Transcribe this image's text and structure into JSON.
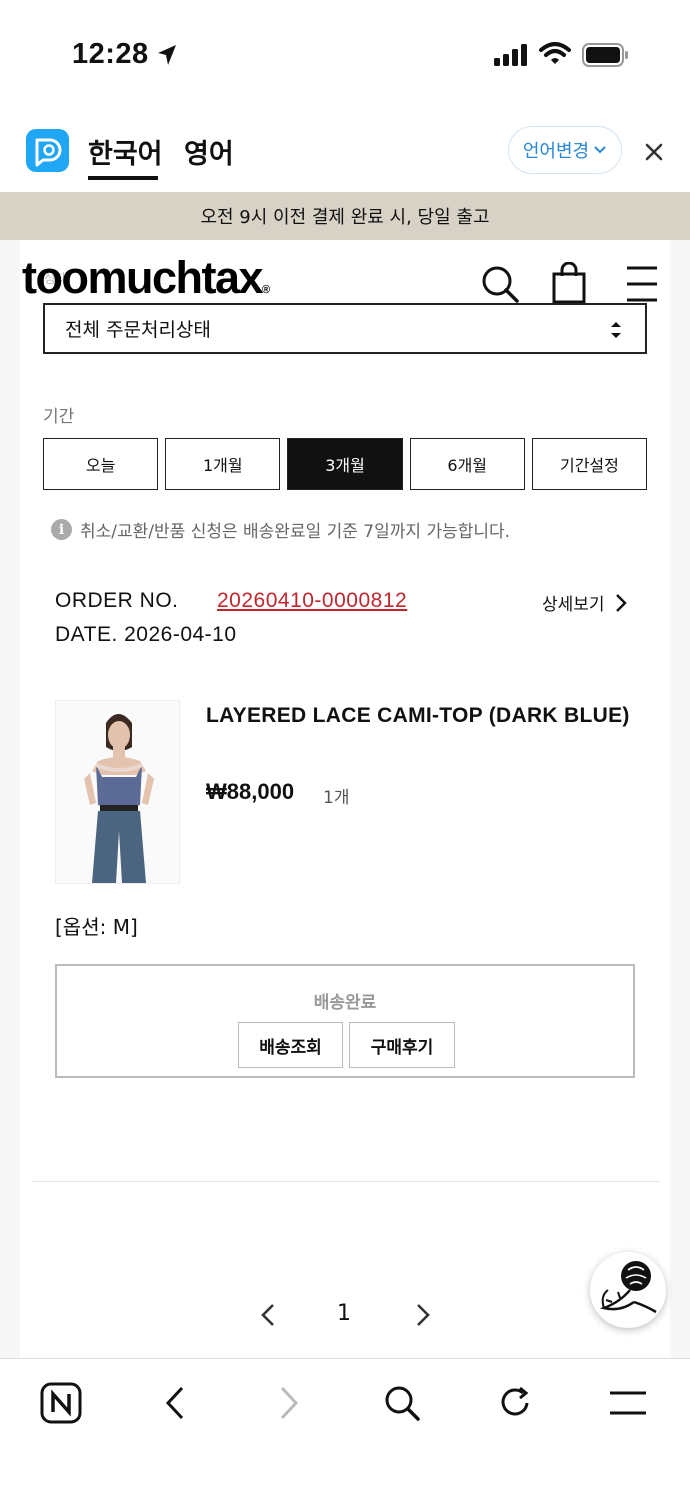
{
  "status_bar": {
    "time": "12:28",
    "icons": [
      "location-arrow-icon",
      "cellular-signal-icon",
      "wifi-icon",
      "battery-icon"
    ]
  },
  "translate_bar": {
    "tab_korean": "한국어",
    "tab_english": "영어",
    "change_language": "언어변경",
    "close_icon": "close-icon"
  },
  "notice": {
    "text": "오전 9시 이전 결제 완료 시, 당일 출고"
  },
  "header": {
    "logo": "toomuchtax",
    "logo_mark": "®",
    "hidden_label": "상태",
    "icons": [
      "search-icon",
      "shopping-bag-icon",
      "hamburger-menu-icon"
    ]
  },
  "filter": {
    "status_select_value": "전체 주문처리상태",
    "period_label": "기간",
    "periods": [
      "오늘",
      "1개월",
      "3개월",
      "6개월",
      "기간설정"
    ],
    "active_period": "3개월",
    "info_text": "취소/교환/반품 신청은 배송완료일 기준 7일까지 가능합니다."
  },
  "order": {
    "order_no_label": "ORDER NO.",
    "order_no_value": "20260410-0000812",
    "date": "DATE. 2026-04-10",
    "detail_link": "상세보기",
    "product_name": "LAYERED LACE CAMI-TOP (DARK BLUE)",
    "price": "₩88,000",
    "quantity": "1개",
    "option": "[옵션: M]",
    "delivery_status": "배송완료",
    "track_button": "배송조회",
    "review_button": "구매후기"
  },
  "pagination": {
    "current_page": "1"
  },
  "colors": {
    "notice_bg": "#d8d1c5",
    "order_link": "#c0272d",
    "active_period_bg": "#111111",
    "papago_blue": "#1fa6f5",
    "lang_change_text": "#2a88d8"
  },
  "browser_toolbar": {
    "icons": [
      "naver-n-icon",
      "back-icon",
      "forward-icon",
      "search-icon",
      "reload-icon",
      "menu-icon"
    ]
  }
}
